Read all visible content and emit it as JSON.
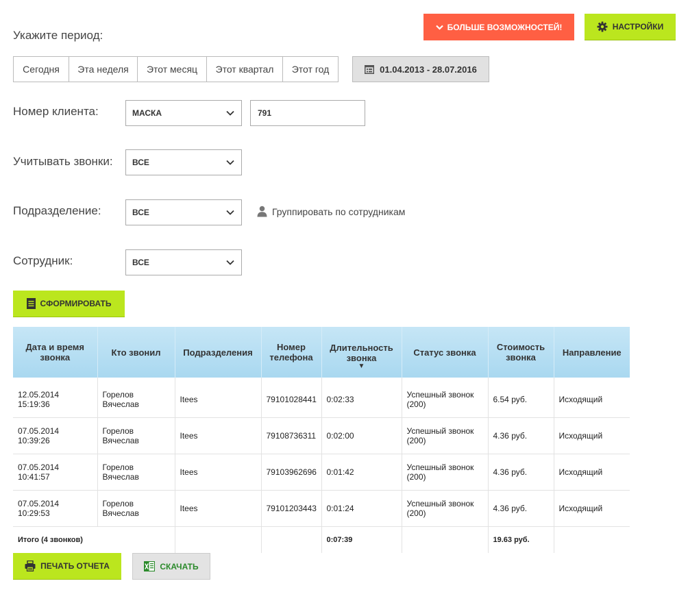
{
  "header": {
    "more_features_label": "БОЛЬШЕ ВОЗМОЖНОСТЕЙ!",
    "settings_label": "НАСТРОЙКИ"
  },
  "period": {
    "label": "Укажите период:",
    "options": [
      "Сегодня",
      "Эта неделя",
      "Этот месяц",
      "Этот квартал",
      "Этот год"
    ],
    "date_range": "01.04.2013 - 28.07.2016"
  },
  "filters": {
    "client_number_label": "Номер клиента:",
    "client_number_mode": "МАСКА",
    "client_number_value": "791",
    "calls_label": "Учитывать звонки:",
    "calls_value": "ВСЕ",
    "department_label": "Подразделение:",
    "department_value": "ВСЕ",
    "group_by_employees_label": "Группировать по сотрудникам",
    "employee_label": "Сотрудник:",
    "employee_value": "ВСЕ"
  },
  "generate_label": "СФОРМИРОВАТЬ",
  "table": {
    "columns": [
      "Дата и время звонка",
      "Кто звонил",
      "Подразделения",
      "Номер телефона",
      "Длительность звонка",
      "Статус звонка",
      "Стоимость звонка",
      "Направление"
    ],
    "sort_indicator": "▼",
    "rows": [
      [
        "12.05.2014 15:19:36",
        "Горелов Вячеслав",
        "Itees",
        "79101028441",
        "0:02:33",
        "Успешный звонок (200)",
        "6.54 руб.",
        "Исходящий"
      ],
      [
        "07.05.2014 10:39:26",
        "Горелов Вячеслав",
        "Itees",
        "79108736311",
        "0:02:00",
        "Успешный звонок (200)",
        "4.36 руб.",
        "Исходящий"
      ],
      [
        "07.05.2014 10:41:57",
        "Горелов Вячеслав",
        "Itees",
        "79103962696",
        "0:01:42",
        "Успешный звонок (200)",
        "4.36 руб.",
        "Исходящий"
      ],
      [
        "07.05.2014 10:29:53",
        "Горелов Вячеслав",
        "Itees",
        "79101203443",
        "0:01:24",
        "Успешный звонок (200)",
        "4.36 руб.",
        "Исходящий"
      ]
    ],
    "total": {
      "label": "Итого (4 звонков)",
      "duration": "0:07:39",
      "cost": "19.63 руб."
    }
  },
  "actions": {
    "print_label": "ПЕЧАТЬ ОТЧЕТА",
    "download_label": "СКАЧАТЬ"
  },
  "colors": {
    "accent_green": "#bbe61e",
    "accent_orange": "#ff5f43",
    "table_header": "#b7def3"
  }
}
